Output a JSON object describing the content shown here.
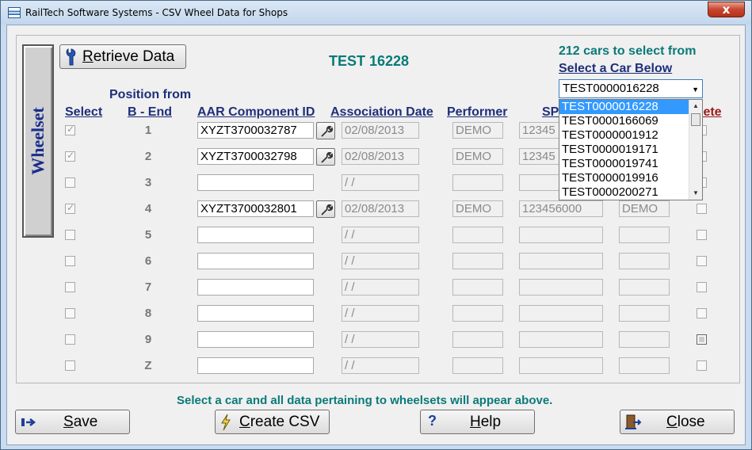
{
  "window": {
    "title": "RailTech Software Systems - CSV Wheel Data for Shops",
    "close_glyph": "x"
  },
  "wheelset_tab": {
    "label": "Wheelset"
  },
  "retrieve_button": {
    "label_first": "R",
    "label_rest": "etrieve Data",
    "icon": "wrench-icon"
  },
  "car_title": "TEST 16228",
  "selector": {
    "count_text": "212 cars to select from",
    "prompt": "Select a Car Below",
    "selected": "TEST0000016228",
    "options": [
      "TEST0000016228",
      "TEST0000166069",
      "TEST0000001912",
      "TEST0000019171",
      "TEST0000019741",
      "TEST0000019916",
      "TEST0000200271"
    ]
  },
  "headers": {
    "select": "Select",
    "position_top": "Position from",
    "position_bottom": "B - End",
    "component": "AAR Component ID",
    "date": "Association Date",
    "performer": "Performer",
    "sp": "SP",
    "delete": "lete"
  },
  "rows": [
    {
      "pos": "1",
      "checked": true,
      "component": "XYZT3700032787",
      "date": "02/08/2013",
      "performer": "DEMO",
      "sp": "12345",
      "col6": "",
      "del_dark": false
    },
    {
      "pos": "2",
      "checked": true,
      "component": "XYZT3700032798",
      "date": "02/08/2013",
      "performer": "DEMO",
      "sp": "12345",
      "col6": "",
      "del_dark": false
    },
    {
      "pos": "3",
      "checked": false,
      "component": "",
      "date": " / /",
      "performer": "",
      "sp": "",
      "col6": "",
      "del_dark": false
    },
    {
      "pos": "4",
      "checked": true,
      "component": "XYZT3700032801",
      "date": "02/08/2013",
      "performer": "DEMO",
      "sp": "123456000",
      "col6": "DEMO",
      "del_dark": false
    },
    {
      "pos": "5",
      "checked": false,
      "component": "",
      "date": " / /",
      "performer": "",
      "sp": "",
      "col6": "",
      "del_dark": false
    },
    {
      "pos": "6",
      "checked": false,
      "component": "",
      "date": " / /",
      "performer": "",
      "sp": "",
      "col6": "",
      "del_dark": false
    },
    {
      "pos": "7",
      "checked": false,
      "component": "",
      "date": " / /",
      "performer": "",
      "sp": "",
      "col6": "",
      "del_dark": false
    },
    {
      "pos": "8",
      "checked": false,
      "component": "",
      "date": " / /",
      "performer": "",
      "sp": "",
      "col6": "",
      "del_dark": false
    },
    {
      "pos": "9",
      "checked": false,
      "component": "",
      "date": " / /",
      "performer": "",
      "sp": "",
      "col6": "",
      "del_dark": true
    },
    {
      "pos": "Z",
      "checked": false,
      "component": "",
      "date": " / /",
      "performer": "",
      "sp": "",
      "col6": "",
      "del_dark": false
    }
  ],
  "status_message": "Select a car and all data pertaining to wheelsets will appear above.",
  "footer": {
    "save": {
      "first": "S",
      "rest": "ave",
      "icon": "save-arrow-icon"
    },
    "create_csv": {
      "first": "C",
      "rest": "reate CSV",
      "icon": "lightning-icon"
    },
    "help": {
      "first": "H",
      "rest": "elp",
      "icon": "question-icon"
    },
    "close": {
      "first": "C",
      "rest": "lose",
      "icon": "exit-door-icon"
    }
  },
  "colors": {
    "header_text": "#1e2f7a",
    "teal_text": "#0a7a78",
    "selection": "#3399ff"
  }
}
